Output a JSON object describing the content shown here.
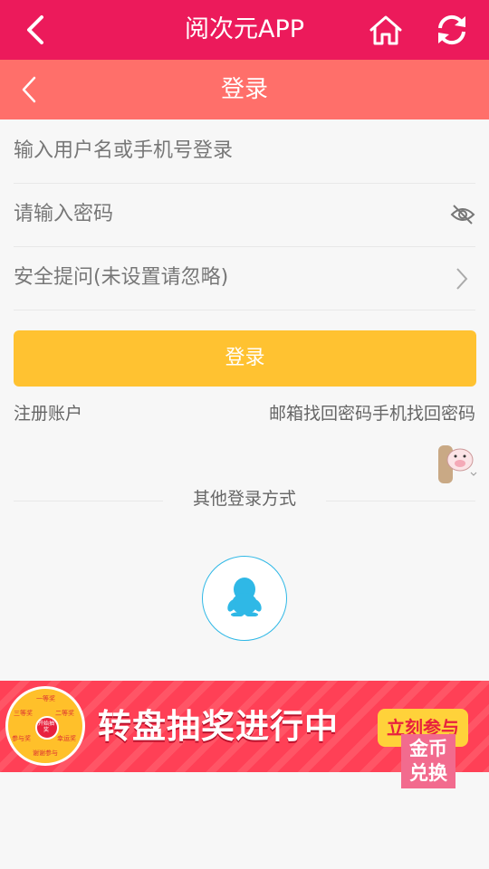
{
  "header": {
    "title": "阅次元APP"
  },
  "subheader": {
    "title": "登录"
  },
  "form": {
    "username_placeholder": "输入用户名或手机号登录",
    "password_placeholder": "请输入密码",
    "security_placeholder": "安全提问(未设置请忽略)",
    "login_label": "登录"
  },
  "links": {
    "register": "注册账户",
    "recover": "邮箱找回密码手机找回密码"
  },
  "other_login": {
    "label": "其他登录方式"
  },
  "banner": {
    "headline": "转盘抽奖进行中",
    "join": "立刻参与",
    "wheel_segments": [
      "一等奖",
      "二等奖",
      "三等奖",
      "谢谢参与",
      "幸运奖",
      "参与奖"
    ],
    "wheel_center": "开始抽奖"
  },
  "coin_badge": {
    "line1": "金币",
    "line2": "兑换"
  },
  "colors": {
    "topbar": "#ec1a5b",
    "subbar": "#ff6f6a",
    "login_button": "#ffc231",
    "qq": "#2fb8e6"
  },
  "icons": [
    "back-icon",
    "home-icon",
    "refresh-icon",
    "eye-hidden-icon",
    "chevron-right-icon",
    "qq-icon"
  ]
}
